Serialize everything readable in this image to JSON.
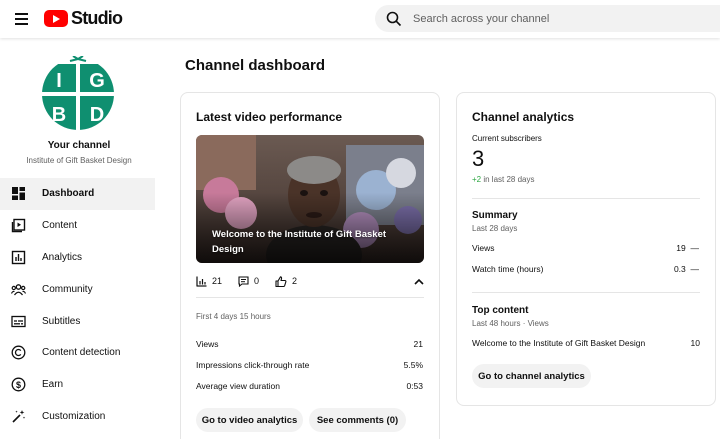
{
  "header": {
    "logo_text": "Studio",
    "search_placeholder": "Search across your channel"
  },
  "sidebar": {
    "channel_title": "Your channel",
    "channel_name": "Institute of Gift Basket Design",
    "avatar_letters": [
      "I",
      "G",
      "B",
      "D"
    ],
    "items": [
      {
        "label": "Dashboard",
        "icon": "dashboard-icon",
        "active": true
      },
      {
        "label": "Content",
        "icon": "content-icon"
      },
      {
        "label": "Analytics",
        "icon": "analytics-icon"
      },
      {
        "label": "Community",
        "icon": "community-icon"
      },
      {
        "label": "Subtitles",
        "icon": "subtitles-icon"
      },
      {
        "label": "Content detection",
        "icon": "copyright-icon"
      },
      {
        "label": "Earn",
        "icon": "dollar-icon"
      },
      {
        "label": "Customization",
        "icon": "magic-wand-icon"
      }
    ]
  },
  "main": {
    "page_title": "Channel dashboard",
    "latest": {
      "title": "Latest video performance",
      "video_title": "Welcome to the Institute of Gift Basket Design",
      "stats": {
        "views": "21",
        "comments": "0",
        "likes": "2"
      },
      "period": "First 4 days 15 hours",
      "rows": [
        {
          "label": "Views",
          "value": "21"
        },
        {
          "label": "Impressions click-through rate",
          "value": "5.5%"
        },
        {
          "label": "Average view duration",
          "value": "0:53"
        }
      ],
      "btn_video_analytics": "Go to video analytics",
      "btn_comments": "See comments (0)"
    },
    "analytics": {
      "title": "Channel analytics",
      "subs_label": "Current subscribers",
      "subs_value": "3",
      "subs_change": "+2",
      "subs_change_suffix": " in last 28 days",
      "summary_title": "Summary",
      "summary_period": "Last 28 days",
      "summary_rows": [
        {
          "label": "Views",
          "value": "19",
          "trend": "—"
        },
        {
          "label": "Watch time (hours)",
          "value": "0.3",
          "trend": "—"
        }
      ],
      "top_title": "Top content",
      "top_period": "Last 48 hours · Views",
      "top_rows": [
        {
          "label": "Welcome to the Institute of Gift Basket Design",
          "value": "10"
        }
      ],
      "btn_channel_analytics": "Go to channel analytics"
    }
  },
  "colors": {
    "brand_red": "#ff0000",
    "avatar_green": "#0f8f70",
    "positive_green": "#2ba640"
  }
}
